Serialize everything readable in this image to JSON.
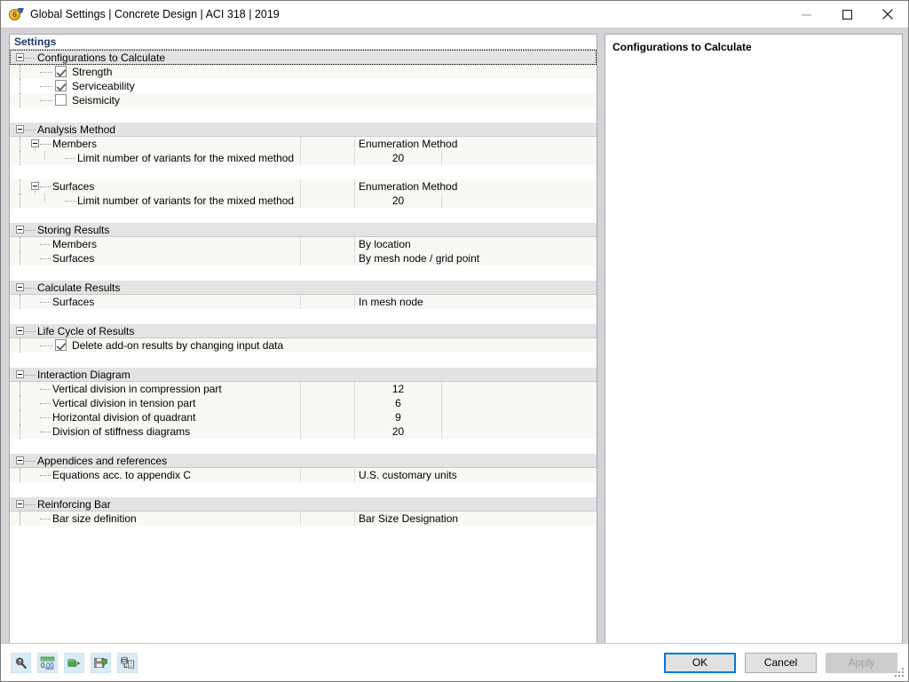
{
  "window": {
    "title": "Global Settings | Concrete Design | ACI 318 | 2019",
    "app_icon": "concrete-design-icon",
    "minimize_label": "—",
    "maximize_label": "□",
    "close_label": "✕"
  },
  "left_panel": {
    "header": "Settings",
    "sections": [
      {
        "id": "configurations-to-calculate",
        "title": "Configurations to Calculate",
        "focused": true,
        "rows": [
          {
            "type": "checkbox",
            "label": "Strength",
            "checked": true,
            "shade": "alt"
          },
          {
            "type": "checkbox",
            "label": "Serviceability",
            "checked": true,
            "shade": "plain"
          },
          {
            "type": "checkbox",
            "label": "Seismicity",
            "checked": false,
            "shade": "alt"
          }
        ]
      },
      {
        "id": "analysis-method",
        "title": "Analysis Method",
        "focused": false,
        "rows": [
          {
            "type": "subgroup",
            "label": "Members",
            "value": "Enumeration Method",
            "shade": "alt"
          },
          {
            "type": "leaf",
            "label": "Limit number of variants for the mixed method",
            "value": "20",
            "numeric": true,
            "shade": "alt"
          },
          {
            "type": "spacer",
            "shade": "plain"
          },
          {
            "type": "subgroup",
            "label": "Surfaces",
            "value": "Enumeration Method",
            "shade": "alt"
          },
          {
            "type": "leaf",
            "label": "Limit number of variants for the mixed method",
            "value": "20",
            "numeric": true,
            "shade": "alt"
          }
        ]
      },
      {
        "id": "storing-results",
        "title": "Storing Results",
        "focused": false,
        "rows": [
          {
            "type": "leaf",
            "label": "Members",
            "value": "By location",
            "numeric": false,
            "shade": "alt"
          },
          {
            "type": "leaf",
            "label": "Surfaces",
            "value": "By mesh node / grid point",
            "numeric": false,
            "shade": "alt"
          }
        ]
      },
      {
        "id": "calculate-results",
        "title": "Calculate Results",
        "focused": false,
        "rows": [
          {
            "type": "leaf",
            "label": "Surfaces",
            "value": "In mesh node",
            "numeric": false,
            "shade": "alt"
          }
        ]
      },
      {
        "id": "life-cycle-of-results",
        "title": "Life Cycle of Results",
        "focused": false,
        "rows": [
          {
            "type": "checkbox",
            "label": "Delete add-on results by changing input data",
            "checked": true,
            "shade": "alt"
          }
        ]
      },
      {
        "id": "interaction-diagram",
        "title": "Interaction Diagram",
        "focused": false,
        "rows": [
          {
            "type": "leaf",
            "label": "Vertical division in compression part",
            "value": "12",
            "numeric": true,
            "shade": "alt"
          },
          {
            "type": "leaf",
            "label": "Vertical division in tension part",
            "value": "6",
            "numeric": true,
            "shade": "alt"
          },
          {
            "type": "leaf",
            "label": "Horizontal division of quadrant",
            "value": "9",
            "numeric": true,
            "shade": "alt"
          },
          {
            "type": "leaf",
            "label": "Division of stiffness diagrams",
            "value": "20",
            "numeric": true,
            "shade": "alt"
          }
        ]
      },
      {
        "id": "appendices-and-references",
        "title": "Appendices and references",
        "focused": false,
        "rows": [
          {
            "type": "leaf",
            "label": "Equations acc. to appendix C",
            "value": "U.S. customary units",
            "numeric": false,
            "shade": "alt"
          }
        ]
      },
      {
        "id": "reinforcing-bar",
        "title": "Reinforcing Bar",
        "focused": false,
        "rows": [
          {
            "type": "leaf",
            "label": "Bar size definition",
            "value": "Bar Size Designation",
            "numeric": false,
            "shade": "alt"
          }
        ]
      }
    ]
  },
  "right_panel": {
    "title": "Configurations to Calculate"
  },
  "footer": {
    "tools": [
      {
        "name": "search-info-icon",
        "tooltip": "Info"
      },
      {
        "name": "units-decimals-icon",
        "tooltip": "Units and Decimal Places",
        "text": "0,00"
      },
      {
        "name": "import-settings-icon",
        "tooltip": "Import"
      },
      {
        "name": "save-settings-icon",
        "tooltip": "Save"
      },
      {
        "name": "copy-report-icon",
        "tooltip": "Report"
      }
    ],
    "buttons": {
      "ok": "OK",
      "cancel": "Cancel",
      "apply": "Apply"
    }
  },
  "colors": {
    "group_row": "#e3e3e3",
    "alt_row": "#f8f8f4",
    "accent": "#0078d7",
    "header_text": "#1f3864",
    "window_bg": "#d4d4d8"
  }
}
